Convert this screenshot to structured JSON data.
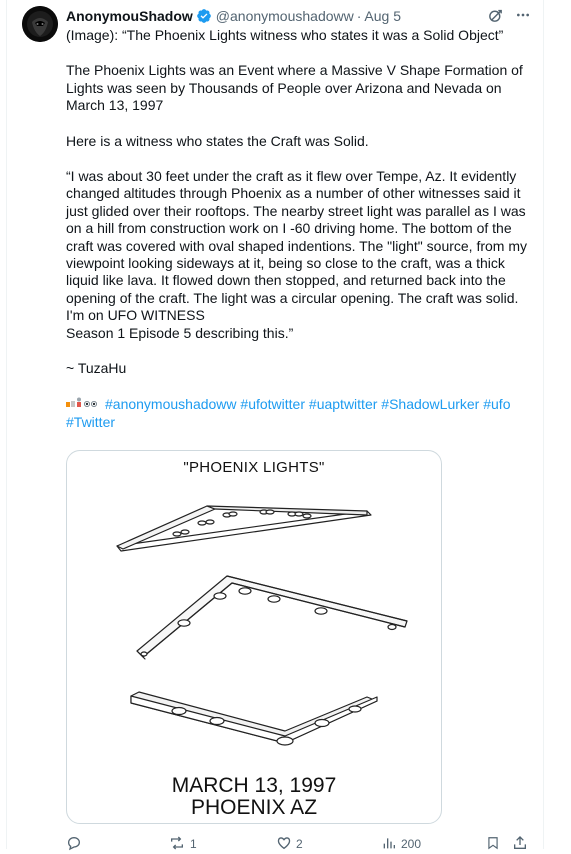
{
  "author": {
    "display_name": "AnonymouShadow",
    "handle": "@anonymoushadoww",
    "separator": "·",
    "time": "Aug 5",
    "verified": true
  },
  "post": {
    "intro": "(Image): “The Phoenix Lights witness who states  it was a Solid Object”",
    "paragraph1": "The Phoenix Lights was an Event where a Massive V Shape Formation of Lights was seen by Thousands of People over Arizona and Nevada on March 13, 1997",
    "paragraph2": "Here is a witness who states the Craft was Solid.",
    "quote_line1": "“I was about 30 feet under the craft as it flew over Tempe, Az. It evidently changed altitudes through Phoenix as a number of other witnesses said it just glided over their rooftops. The nearby street light was parallel as I was on a hill from construction work on I -60 driving home. The bottom of the craft was covered with oval shaped indentions. The \"light\" source, from my viewpoint looking sideways at it, being so close to the craft, was a thick liquid like lava. It flowed down then stopped, and returned back into the opening of the craft. The light was a circular opening. The craft was solid. I'm on UFO WITNESS",
    "quote_line2": "Season 1 Episode 5 describing this.”",
    "attribution": "~ TuzaHu",
    "hashtags": [
      "#anonymoushadoww",
      "#ufotwitter",
      "#uaptwitter",
      "#ShadowLurker",
      "#ufo",
      "#Twitter"
    ]
  },
  "media": {
    "title": "\"PHOENIX LIGHTS\"",
    "caption_line1": "MARCH 13, 1997",
    "caption_line2": "PHOENIX AZ"
  },
  "actions": {
    "reply_count": "",
    "repost_count": "1",
    "like_count": "2",
    "views_count": "200"
  },
  "icons": {
    "verified": "verified-badge-icon",
    "grok": "grok-icon",
    "more": "more-icon",
    "reply": "reply-icon",
    "repost": "repost-icon",
    "like": "like-icon",
    "views": "views-icon",
    "bookmark": "bookmark-icon",
    "share": "share-icon"
  },
  "colors": {
    "accent": "#1d9bf0",
    "text": "#0f1419",
    "muted": "#536471"
  }
}
